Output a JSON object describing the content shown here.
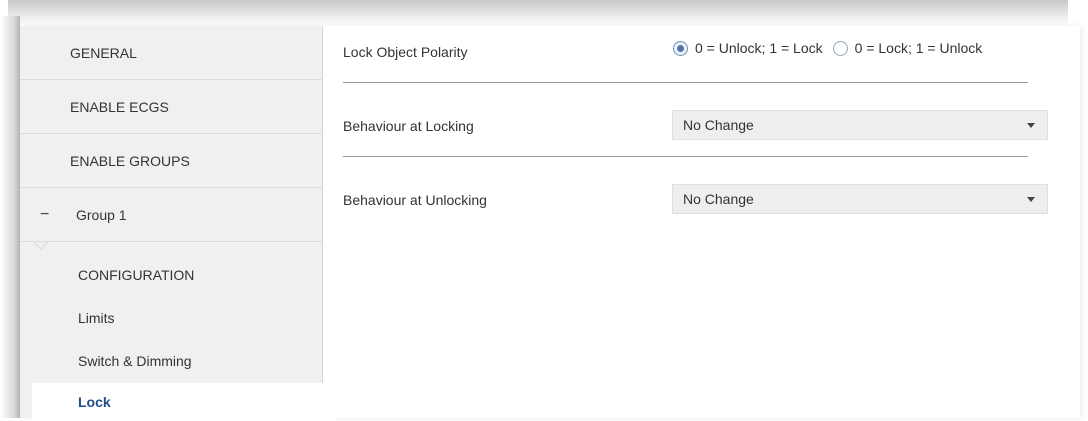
{
  "sidebar": {
    "items": [
      {
        "label": "GENERAL"
      },
      {
        "label": "ENABLE ECGS"
      },
      {
        "label": "ENABLE GROUPS"
      },
      {
        "label": "Group 1",
        "expander": "−"
      }
    ],
    "subitems": [
      {
        "label": "CONFIGURATION"
      },
      {
        "label": "Limits"
      },
      {
        "label": "Switch & Dimming"
      },
      {
        "label": "Lock",
        "active": true
      }
    ]
  },
  "main": {
    "lock_polarity": {
      "label": "Lock Object Polarity",
      "options": [
        {
          "label": "0 = Unlock; 1 = Lock",
          "checked": true
        },
        {
          "label": "0 = Lock; 1 = Unlock",
          "checked": false
        }
      ]
    },
    "behaviour_locking": {
      "label": "Behaviour at Locking",
      "value": "No Change"
    },
    "behaviour_unlocking": {
      "label": "Behaviour at Unlocking",
      "value": "No Change"
    }
  },
  "colors": {
    "sidebar_bg": "#f0f0f0",
    "active_text": "#1f4e8c",
    "radio_accent": "#4f78a8",
    "select_bg": "#eeeeee"
  }
}
